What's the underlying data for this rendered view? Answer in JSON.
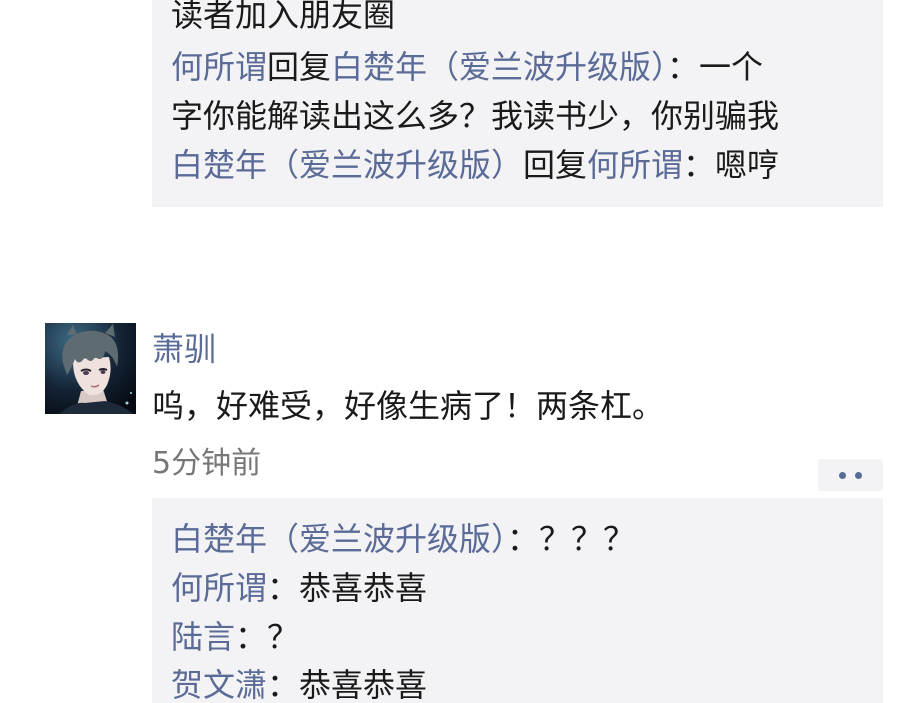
{
  "top_comments": {
    "line1": {
      "text": "读者加入朋友圈"
    },
    "line2": {
      "name_a": "何所谓",
      "reply_word": "回复",
      "name_b": "白楚年（爱兰波升级版）",
      "text": "：一个"
    },
    "line3": {
      "text": "字你能解读出这么多？我读书少，你别骗我"
    },
    "line4": {
      "name_a": "白楚年（爱兰波升级版）",
      "reply_word": "回复",
      "name_b": "何所谓",
      "text": "：嗯哼"
    }
  },
  "post": {
    "avatar_icon": "anime-boy-avatar",
    "author": "萧驯",
    "text": "呜，好难受，好像生病了！两条杠。",
    "time": "5分钟前",
    "more_icon": "more-dots-icon"
  },
  "bottom_comments": [
    {
      "name": "白楚年（爱兰波升级版）",
      "text": "：？？？"
    },
    {
      "name": "何所谓",
      "text": "：恭喜恭喜"
    },
    {
      "name": "陆言",
      "text": "：？"
    },
    {
      "name": "贺文潇",
      "text": "：恭喜恭喜"
    }
  ],
  "colors": {
    "name_link": "#5b6b97",
    "comment_bg": "#f3f3f5",
    "time_gray": "#777777"
  }
}
